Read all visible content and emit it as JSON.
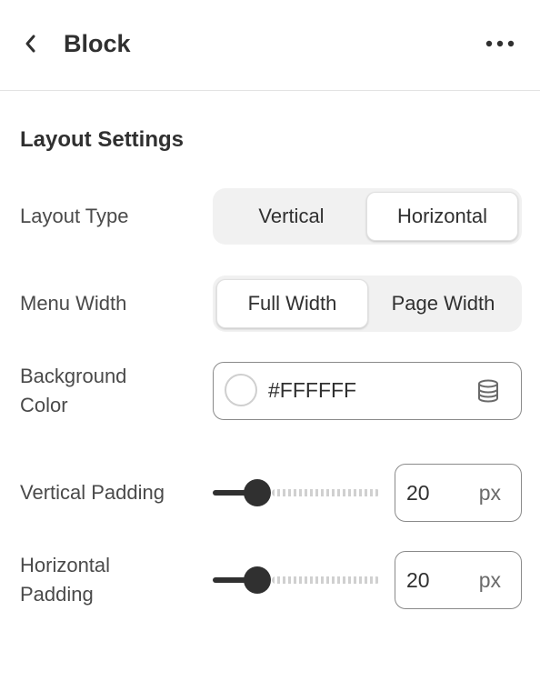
{
  "header": {
    "back_icon": "chevron-left-icon",
    "title": "Block",
    "more_icon": "ellipsis-horizontal-icon"
  },
  "section": {
    "title": "Layout Settings"
  },
  "layout_type": {
    "label": "Layout Type",
    "options": [
      "Vertical",
      "Horizontal"
    ],
    "selected": "Horizontal"
  },
  "menu_width": {
    "label": "Menu Width",
    "options": [
      "Full Width",
      "Page Width"
    ],
    "selected": "Full Width"
  },
  "background_color": {
    "label_line1": "Background",
    "label_line2": "Color",
    "value": "#FFFFFF",
    "swatch_color": "#FFFFFF",
    "source_icon": "database-icon"
  },
  "vertical_padding": {
    "label": "Vertical Padding",
    "value": "20",
    "unit": "px",
    "slider_fraction": 0.25
  },
  "horizontal_padding": {
    "label_line1": "Horizontal",
    "label_line2": "Padding",
    "value": "20",
    "unit": "px",
    "slider_fraction": 0.25
  },
  "colors": {
    "text_primary": "#303030",
    "segment_track": "#f1f1f1",
    "slider_active": "#303030"
  }
}
